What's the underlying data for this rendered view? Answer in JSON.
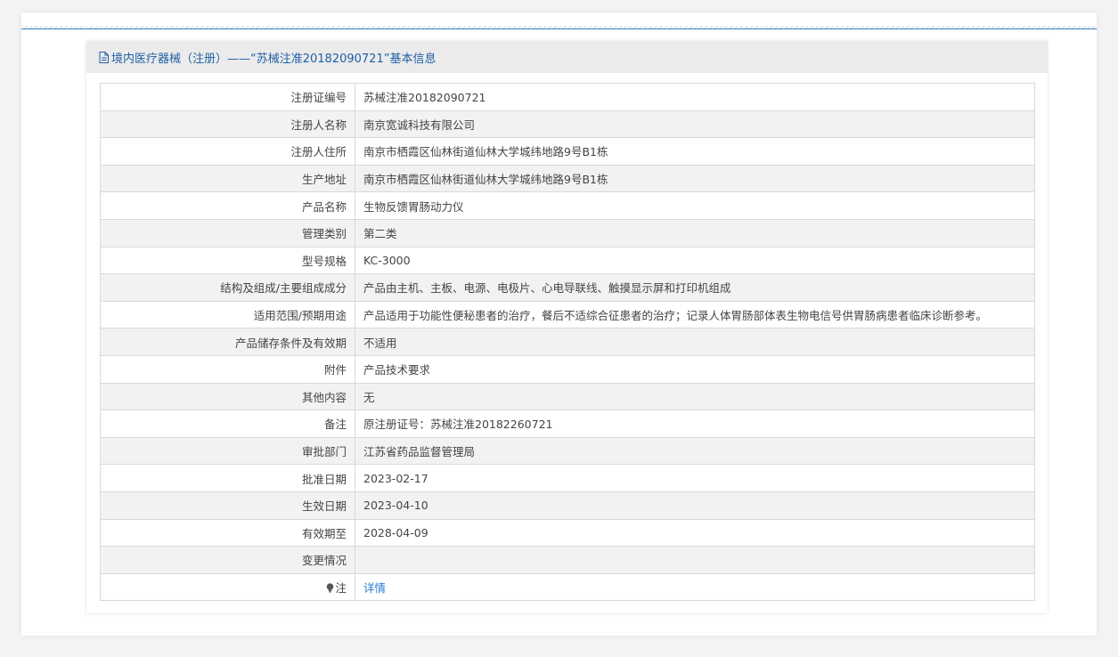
{
  "header": {
    "title": "境内医疗器械（注册）——“苏械注准20182090721”基本信息",
    "icon": "document-icon"
  },
  "rows": [
    {
      "label": "注册证编号",
      "value": "苏械注准20182090721"
    },
    {
      "label": "注册人名称",
      "value": "南京宽诚科技有限公司"
    },
    {
      "label": "注册人住所",
      "value": "南京市栖霞区仙林街道仙林大学城纬地路9号B1栋"
    },
    {
      "label": "生产地址",
      "value": "南京市栖霞区仙林街道仙林大学城纬地路9号B1栋"
    },
    {
      "label": "产品名称",
      "value": "生物反馈胃肠动力仪"
    },
    {
      "label": "管理类别",
      "value": "第二类"
    },
    {
      "label": "型号规格",
      "value": "KC-3000"
    },
    {
      "label": "结构及组成/主要组成成分",
      "value": "产品由主机、主板、电源、电极片、心电导联线、触摸显示屏和打印机组成"
    },
    {
      "label": "适用范围/预期用途",
      "value": "产品适用于功能性便秘患者的治疗，餐后不适综合征患者的治疗；记录人体胃肠部体表生物电信号供胃肠病患者临床诊断参考。"
    },
    {
      "label": "产品储存条件及有效期",
      "value": "不适用"
    },
    {
      "label": "附件",
      "value": "产品技术要求"
    },
    {
      "label": "其他内容",
      "value": "无"
    },
    {
      "label": "备注",
      "value": "原注册证号：苏械注准20182260721"
    },
    {
      "label": "审批部门",
      "value": "江苏省药品监督管理局"
    },
    {
      "label": "批准日期",
      "value": "2023-02-17"
    },
    {
      "label": "生效日期",
      "value": "2023-04-10"
    },
    {
      "label": "有效期至",
      "value": "2028-04-09"
    },
    {
      "label": "变更情况",
      "value": ""
    }
  ],
  "note_row": {
    "label": "注",
    "icon": "lightbulb-icon",
    "link": "详情"
  },
  "colors": {
    "header_bg": "#ebebeb",
    "title": "#1f5fa6",
    "link": "#2a7ad2",
    "rule": "#3a7fc1"
  }
}
